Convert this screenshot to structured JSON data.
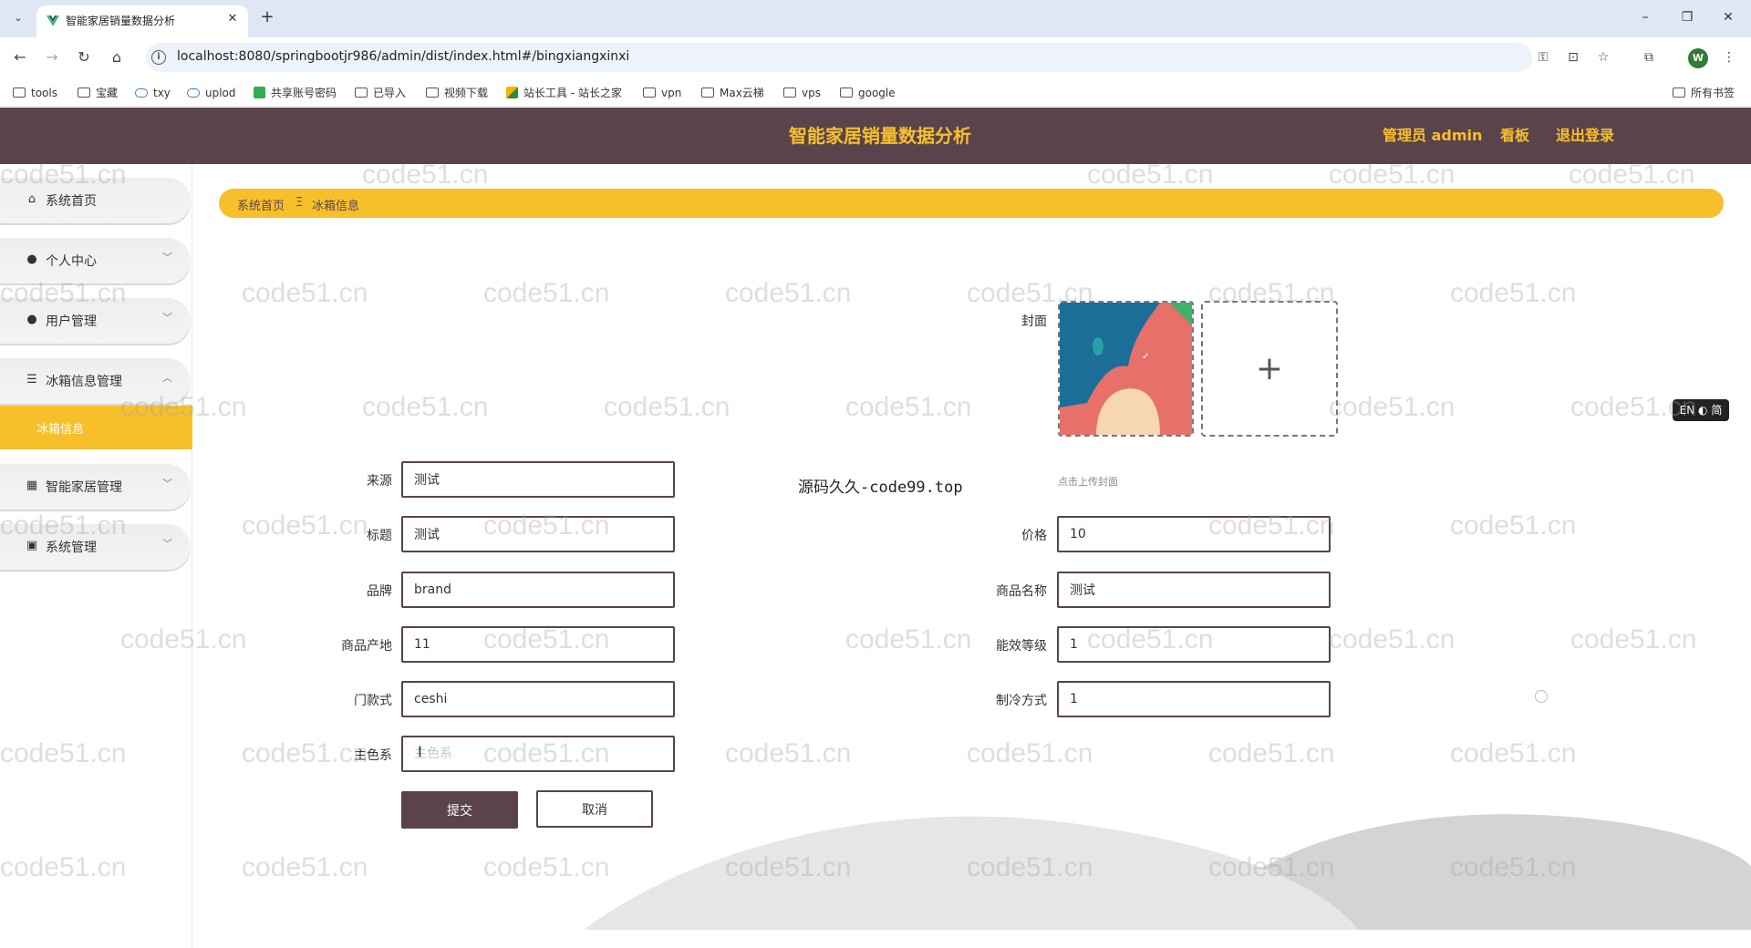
{
  "browser": {
    "tab_title": "智能家居销量数据分析",
    "url": "localhost:8080/springbootjr986/admin/dist/index.html#/bingxiangxinxi",
    "profile_initial": "W",
    "bookmarks": [
      "tools",
      "宝藏",
      "txy",
      "uplod",
      "共享账号密码",
      "已导入",
      "视频下载",
      "站长工具 - 站长之家",
      "vpn",
      "Max云梯",
      "vps",
      "google"
    ],
    "all_bookmarks": "所有书签"
  },
  "header": {
    "title": "智能家居销量数据分析",
    "admin": "管理员 admin",
    "board": "看板",
    "logout": "退出登录",
    "accent_color": "#f7c02b",
    "bg_color": "#5a434b"
  },
  "sidebar": {
    "items": [
      {
        "label": "系统首页",
        "icon": "home-icon"
      },
      {
        "label": "个人中心",
        "icon": "user-icon"
      },
      {
        "label": "用户管理",
        "icon": "pin-icon"
      },
      {
        "label": "冰箱信息管理",
        "icon": "sliders-icon"
      },
      {
        "label": "智能家居管理",
        "icon": "grid-icon"
      },
      {
        "label": "系统管理",
        "icon": "calendar-icon"
      }
    ],
    "active_sub": "冰箱信息"
  },
  "breadcrumb": {
    "home": "系统首页",
    "sep": "Ξ",
    "current": "冰箱信息"
  },
  "form": {
    "cover_label": "封面",
    "upload_hint": "点击上传封面",
    "source_text": "源码久久-code99.top",
    "fields": {
      "laiyuan": {
        "label": "来源",
        "value": "测试"
      },
      "biaoti": {
        "label": "标题",
        "value": "测试"
      },
      "pinpai": {
        "label": "品牌",
        "value": "brand"
      },
      "chandi": {
        "label": "商品产地",
        "value": "11"
      },
      "menkuan": {
        "label": "门款式",
        "value": "ceshi"
      },
      "zhuse": {
        "label": "主色系",
        "value": "",
        "placeholder": "主色系"
      },
      "jiage": {
        "label": "价格",
        "value": "10"
      },
      "mingcheng": {
        "label": "商品名称",
        "value": "测试"
      },
      "nengxiao": {
        "label": "能效等级",
        "value": "1"
      },
      "zhileng": {
        "label": "制冷方式",
        "value": "1"
      }
    },
    "submit": "提交",
    "cancel": "取消"
  },
  "lang_badge": "EN ◐ 简",
  "watermark": "code51.cn"
}
